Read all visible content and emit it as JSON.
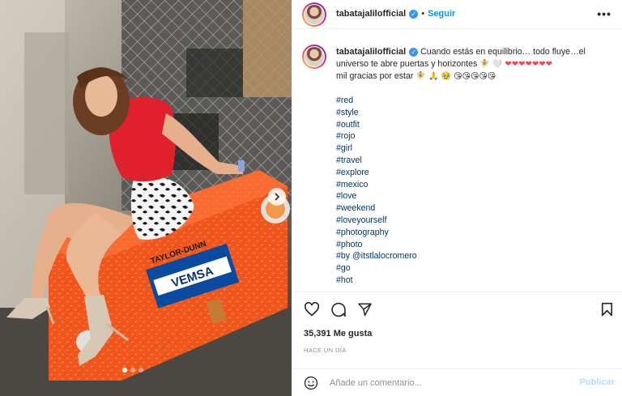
{
  "post": {
    "username": "tabatajalilofficial",
    "follow_label": "Seguir",
    "separator": "•",
    "more_label": "•••"
  },
  "caption": {
    "username": "tabatajalilofficial",
    "line1": "Cuando estás en equilibrio… todo fluye…el universo te abre puertas y horizontes",
    "line1_emoji": "🧚 🤍",
    "hearts": "❤❤❤❤❤❤❤",
    "line2": "mil gracias por estar",
    "line2_emoji": "🧚 🙏 🥹 😘😘😘😘😘"
  },
  "hashtags": [
    "#red",
    "#style",
    "#outfit",
    "#rojo",
    "#girl",
    "#travel",
    "#explore",
    "#mexico",
    "#love",
    "#weekend",
    "#loveyourself",
    "#photography",
    "#photo",
    "#by @itstlalocromero",
    "#go",
    "#hot"
  ],
  "stats": {
    "likes": "35,391 Me gusta",
    "time": "HACE UN DÍA"
  },
  "comment_box": {
    "placeholder": "Añade un comentario...",
    "publish_label": "Publicar"
  },
  "photo": {
    "box_brand": "TAYLOR-DUNN",
    "sticker_text": "VEMSA",
    "carousel_total": 3,
    "carousel_active": 1
  },
  "icons": [
    "heart-icon",
    "comment-icon",
    "share-icon",
    "bookmark-icon",
    "smiley-icon",
    "verified-icon",
    "chevron-right-icon"
  ],
  "colors": {
    "link": "#00376b",
    "follow": "#0095f6",
    "publish_disabled": "#b2dffc",
    "verified": "#3897f0",
    "heart": "#ed4956"
  }
}
